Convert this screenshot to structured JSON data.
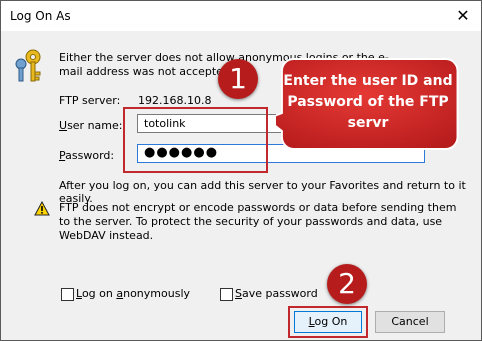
{
  "window": {
    "title": "Log On As"
  },
  "info": {
    "message": "Either the server does not allow anonymous logins or the e-mail address was not accepted."
  },
  "server": {
    "label": "FTP server:",
    "value": "192.168.10.8"
  },
  "username": {
    "label_u": "U",
    "label_rest": "ser name:",
    "value": "totolink"
  },
  "password": {
    "label_u": "P",
    "label_rest": "assword:",
    "value": "●●●●●●"
  },
  "hint": "After you log on, you can add this server to your Favorites and return to it easily.",
  "warning": "FTP does not encrypt or encode passwords or data before sending them to the server.  To protect the security of your passwords and data, use WebDAV instead.",
  "options": {
    "anon_u": "L",
    "anon_rest": "og on ",
    "anon_u2": "a",
    "anon_rest2": "nonymously",
    "save_u": "S",
    "save_rest": "ave password"
  },
  "buttons": {
    "logon_u": "L",
    "logon_rest": "og On",
    "cancel": "Cancel"
  },
  "annotations": {
    "step1": "1",
    "step2": "2",
    "callout": "Enter the user ID and Password of the FTP servr"
  },
  "colors": {
    "annotation_red": "#b71c1c",
    "callout_red": "#c62828",
    "focus_blue": "#2b79d8"
  }
}
